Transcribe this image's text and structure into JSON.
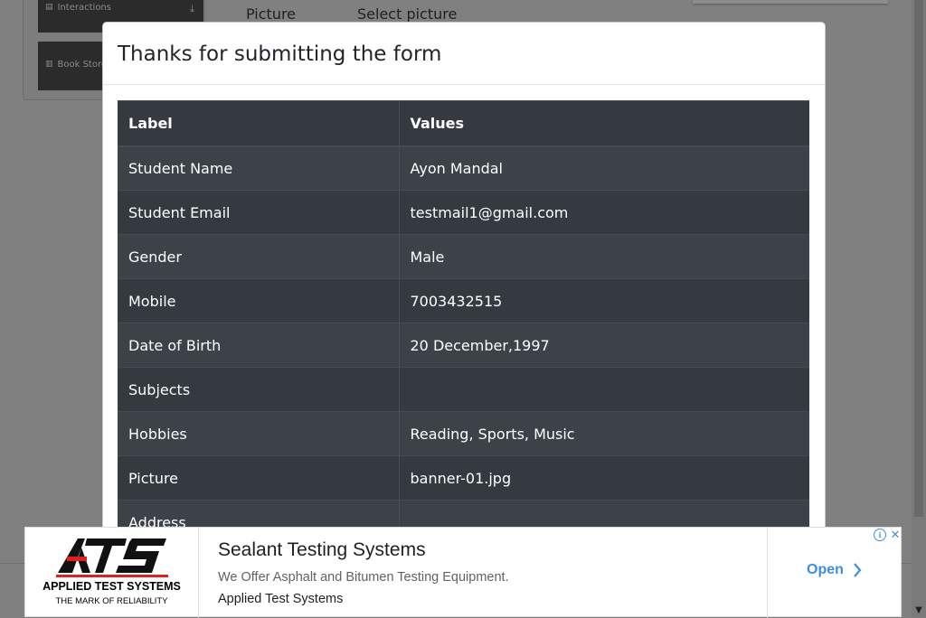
{
  "background": {
    "sidebar": [
      {
        "label": "Interactions",
        "icon": "list-icon"
      },
      {
        "label": "Book Store",
        "icon": "chart-icon"
      }
    ],
    "form_row": {
      "label": "Picture",
      "value": "Select picture"
    }
  },
  "modal": {
    "title": "Thanks for submitting the form",
    "table": {
      "headers": [
        "Label",
        "Values"
      ],
      "rows": [
        {
          "label": "Student Name",
          "value": "Ayon Mandal"
        },
        {
          "label": "Student Email",
          "value": "testmail1@gmail.com"
        },
        {
          "label": "Gender",
          "value": "Male"
        },
        {
          "label": "Mobile",
          "value": "7003432515"
        },
        {
          "label": "Date of Birth",
          "value": "20 December,1997"
        },
        {
          "label": "Subjects",
          "value": ""
        },
        {
          "label": "Hobbies",
          "value": "Reading, Sports, Music"
        },
        {
          "label": "Picture",
          "value": "banner-01.jpg"
        },
        {
          "label": "Address",
          "value": ""
        }
      ]
    }
  },
  "ad": {
    "logo_text": "ATS",
    "logo_line1": "APPLIED TEST SYSTEMS",
    "logo_line2": "THE MARK OF RELIABILITY",
    "headline": "Sealant Testing Systems",
    "description": "We Offer Asphalt and Bitumen Testing Equipment.",
    "advertiser": "Applied Test Systems",
    "cta": "Open",
    "colors": {
      "cta": "#3c8ee4",
      "logo_red": "#e02020"
    }
  }
}
